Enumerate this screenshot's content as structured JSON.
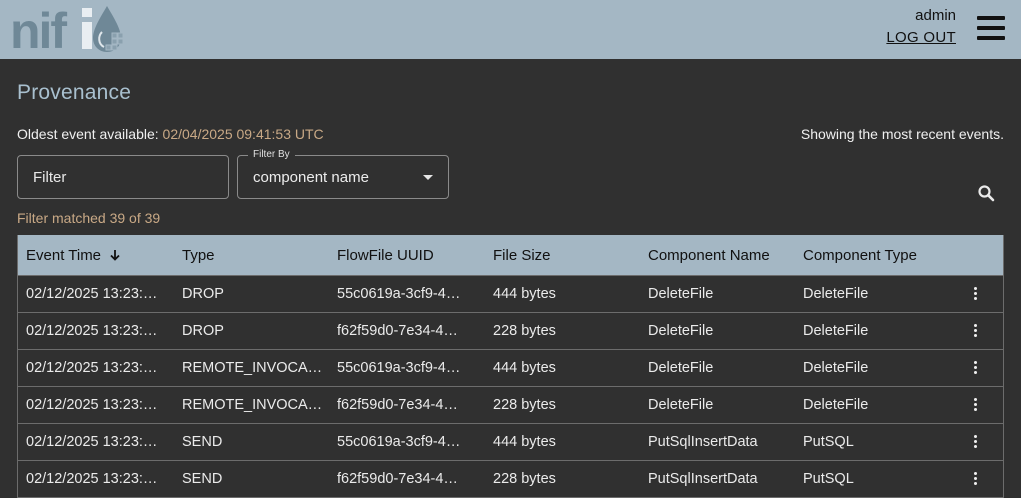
{
  "header": {
    "user": "admin",
    "logout_label": "LOG OUT",
    "logo_icon": "nifi-logo",
    "menu_icon": "hamburger-menu-icon"
  },
  "page": {
    "title": "Provenance",
    "oldest_label": "Oldest event available:",
    "oldest_value": "02/04/2025 09:41:53 UTC",
    "showing": "Showing the most recent events."
  },
  "filter": {
    "placeholder": "Filter",
    "by_label": "Filter By",
    "by_value": "component name",
    "matched": "Filter matched 39 of 39"
  },
  "table": {
    "columns": [
      "Event Time",
      "Type",
      "FlowFile UUID",
      "File Size",
      "Component Name",
      "Component Type"
    ],
    "rows": [
      {
        "time": "02/12/2025 13:23:…",
        "type": "DROP",
        "uuid": "55c0619a-3cf9-4…",
        "size": "444 bytes",
        "name": "DeleteFile",
        "ctype": "DeleteFile"
      },
      {
        "time": "02/12/2025 13:23:…",
        "type": "DROP",
        "uuid": "f62f59d0-7e34-4…",
        "size": "228 bytes",
        "name": "DeleteFile",
        "ctype": "DeleteFile"
      },
      {
        "time": "02/12/2025 13:23:…",
        "type": "REMOTE_INVOCA…",
        "uuid": "55c0619a-3cf9-4…",
        "size": "444 bytes",
        "name": "DeleteFile",
        "ctype": "DeleteFile"
      },
      {
        "time": "02/12/2025 13:23:…",
        "type": "REMOTE_INVOCA…",
        "uuid": "f62f59d0-7e34-4…",
        "size": "228 bytes",
        "name": "DeleteFile",
        "ctype": "DeleteFile"
      },
      {
        "time": "02/12/2025 13:23:…",
        "type": "SEND",
        "uuid": "55c0619a-3cf9-4…",
        "size": "444 bytes",
        "name": "PutSqlInsertData",
        "ctype": "PutSQL"
      },
      {
        "time": "02/12/2025 13:23:…",
        "type": "SEND",
        "uuid": "f62f59d0-7e34-4…",
        "size": "228 bytes",
        "name": "PutSqlInsertData",
        "ctype": "PutSQL"
      }
    ]
  },
  "colors": {
    "header_bg": "#a4b7c4",
    "page_bg": "#303030",
    "accent_text": "#c9a986",
    "title_text": "#a9c0cf"
  }
}
